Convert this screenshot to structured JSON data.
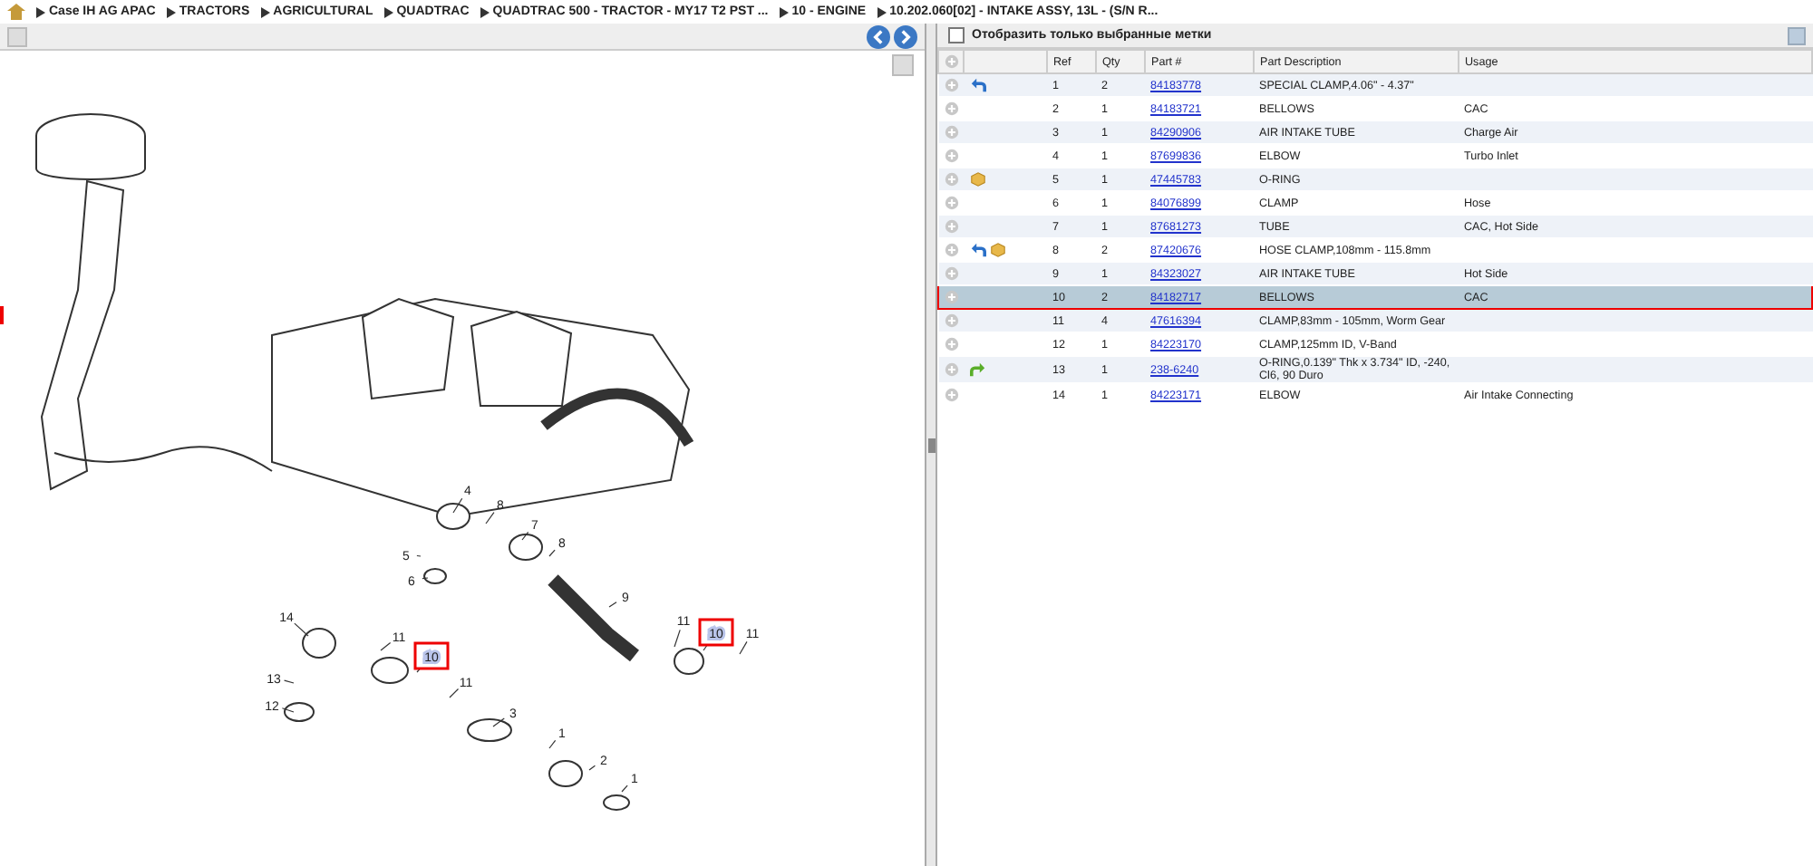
{
  "breadcrumb": [
    "Case IH AG APAC",
    "TRACTORS",
    "AGRICULTURAL",
    "QUADTRAC",
    "QUADTRAC 500 - TRACTOR - MY17 T2 PST ...",
    "10 - ENGINE",
    "10.202.060[02] - INTAKE ASSY, 13L - (S/N R..."
  ],
  "diagram": {
    "callouts": [
      {
        "label": "4",
        "highlighted": false
      },
      {
        "label": "8",
        "highlighted": false
      },
      {
        "label": "7",
        "highlighted": false
      },
      {
        "label": "8",
        "highlighted": false
      },
      {
        "label": "5",
        "highlighted": false
      },
      {
        "label": "6",
        "highlighted": false
      },
      {
        "label": "9",
        "highlighted": false
      },
      {
        "label": "14",
        "highlighted": false
      },
      {
        "label": "11",
        "highlighted": false
      },
      {
        "label": "10",
        "highlighted": true
      },
      {
        "label": "11",
        "highlighted": false
      },
      {
        "label": "10",
        "highlighted": true
      },
      {
        "label": "11",
        "highlighted": false
      },
      {
        "label": "13",
        "highlighted": false
      },
      {
        "label": "11",
        "highlighted": false
      },
      {
        "label": "12",
        "highlighted": false
      },
      {
        "label": "3",
        "highlighted": false
      },
      {
        "label": "1",
        "highlighted": false
      },
      {
        "label": "2",
        "highlighted": false
      },
      {
        "label": "1",
        "highlighted": false
      }
    ]
  },
  "parts_panel": {
    "filter_checkbox": {
      "label": "Отобразить только выбранные метки",
      "checked": false
    },
    "columns": [
      "Ref",
      "Qty",
      "Part #",
      "Part Description",
      "Usage"
    ],
    "rows": [
      {
        "icons": [
          {
            "kind": "arrow"
          }
        ],
        "ref": "1",
        "qty": "2",
        "part": "84183778",
        "description": "SPECIAL CLAMP,4.06\" - 4.37\"",
        "usage": "",
        "selected": false
      },
      {
        "icons": [],
        "ref": "2",
        "qty": "1",
        "part": "84183721",
        "description": "BELLOWS",
        "usage": "CAC",
        "selected": false
      },
      {
        "icons": [],
        "ref": "3",
        "qty": "1",
        "part": "84290906",
        "description": "AIR INTAKE TUBE",
        "usage": "Charge Air",
        "selected": false
      },
      {
        "icons": [],
        "ref": "4",
        "qty": "1",
        "part": "87699836",
        "description": "ELBOW",
        "usage": "Turbo Inlet",
        "selected": false
      },
      {
        "icons": [
          {
            "kind": "box"
          }
        ],
        "ref": "5",
        "qty": "1",
        "part": "47445783",
        "description": "O-RING",
        "usage": "",
        "selected": false
      },
      {
        "icons": [],
        "ref": "6",
        "qty": "1",
        "part": "84076899",
        "description": "CLAMP",
        "usage": "Hose",
        "selected": false
      },
      {
        "icons": [],
        "ref": "7",
        "qty": "1",
        "part": "87681273",
        "description": "TUBE",
        "usage": "CAC, Hot Side",
        "selected": false
      },
      {
        "icons": [
          {
            "kind": "arrow"
          },
          {
            "kind": "box"
          }
        ],
        "ref": "8",
        "qty": "2",
        "part": "87420676",
        "description": "HOSE CLAMP,108mm - 115.8mm",
        "usage": "",
        "selected": false
      },
      {
        "icons": [],
        "ref": "9",
        "qty": "1",
        "part": "84323027",
        "description": "AIR INTAKE TUBE",
        "usage": "Hot Side",
        "selected": false
      },
      {
        "icons": [],
        "ref": "10",
        "qty": "2",
        "part": "84182717",
        "description": "BELLOWS",
        "usage": "CAC",
        "selected": true
      },
      {
        "icons": [],
        "ref": "11",
        "qty": "4",
        "part": "47616394",
        "description": "CLAMP,83mm - 105mm, Worm Gear",
        "usage": "",
        "selected": false
      },
      {
        "icons": [],
        "ref": "12",
        "qty": "1",
        "part": "84223170",
        "description": "CLAMP,125mm ID, V-Band",
        "usage": "",
        "selected": false
      },
      {
        "icons": [
          {
            "kind": "green-arrow"
          }
        ],
        "ref": "13",
        "qty": "1",
        "part": "238-6240",
        "description": "O-RING,0.139\" Thk x 3.734\" ID, -240, Cl6, 90 Duro",
        "usage": "",
        "selected": false
      },
      {
        "icons": [],
        "ref": "14",
        "qty": "1",
        "part": "84223171",
        "description": "ELBOW",
        "usage": "Air Intake Connecting",
        "selected": false
      }
    ]
  }
}
